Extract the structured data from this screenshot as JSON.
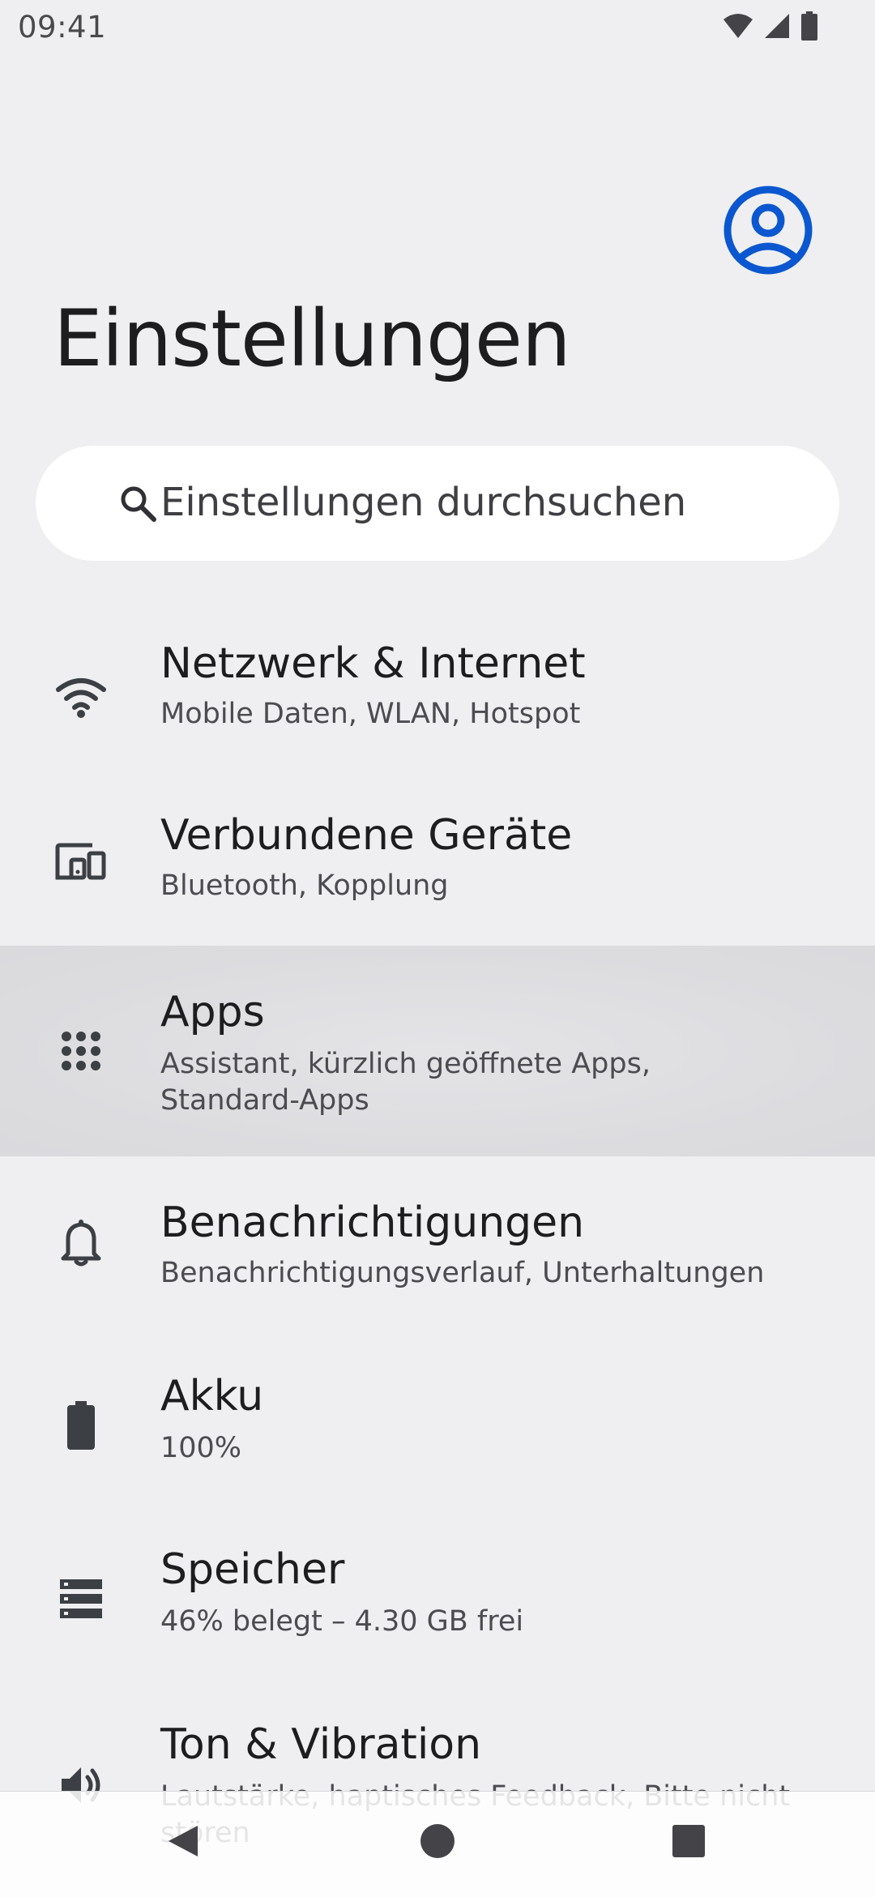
{
  "status_bar": {
    "time": "09:41",
    "icons": [
      "wifi-icon",
      "cellular-signal-icon",
      "battery-icon"
    ]
  },
  "header": {
    "title": "Einstellungen",
    "account_icon": "account-circle-icon"
  },
  "search": {
    "placeholder": "Einstellungen durchsuchen",
    "icon": "search-icon"
  },
  "settings": {
    "items": [
      {
        "id": "network",
        "icon": "wifi-icon",
        "title": "Netzwerk & Internet",
        "subtitle": "Mobile Daten, WLAN, Hotspot"
      },
      {
        "id": "devices",
        "icon": "connected-devices-icon",
        "title": "Verbundene Geräte",
        "subtitle": "Bluetooth, Kopplung"
      },
      {
        "id": "apps",
        "icon": "apps-grid-icon",
        "title": "Apps",
        "subtitle": "Assistant, kürzlich geöffnete Apps, Standard-Apps",
        "highlighted": true
      },
      {
        "id": "notifications",
        "icon": "bell-icon",
        "title": "Benachrichtigungen",
        "subtitle": "Benachrichtigungsverlauf, Unterhaltungen"
      },
      {
        "id": "battery",
        "icon": "battery-icon",
        "title": "Akku",
        "subtitle": "100%"
      },
      {
        "id": "storage",
        "icon": "storage-icon",
        "title": "Speicher",
        "subtitle": "46% belegt – 4.30 GB frei"
      },
      {
        "id": "sound",
        "icon": "volume-icon",
        "title": "Ton & Vibration",
        "subtitle": "Lautstärke, haptisches Feedback, Bitte nicht stören"
      }
    ]
  },
  "nav_bar": {
    "buttons": [
      "back-icon",
      "home-icon",
      "recents-icon"
    ]
  },
  "colors": {
    "background": "#efeff2",
    "accent": "#0b57d0",
    "icon": "#3c3f44",
    "highlight": "#dcdcdf"
  }
}
